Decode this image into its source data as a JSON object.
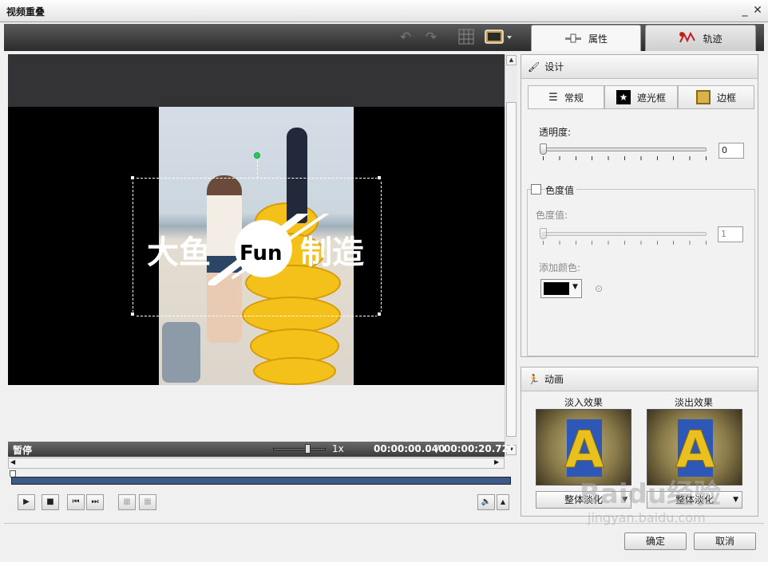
{
  "window": {
    "title": "视频重叠",
    "minimize": "_",
    "close": "✕"
  },
  "toolbar": {
    "icons": [
      "undo-icon",
      "redo-icon",
      "grid-icon",
      "monitor-icon"
    ]
  },
  "tabs": [
    {
      "label": "属性"
    },
    {
      "label": "轨迹"
    }
  ],
  "preview": {
    "overlay_text_left": "大鱼",
    "overlay_text_mid": "Fun",
    "overlay_text_right": "制造"
  },
  "status": {
    "state": "暂停",
    "speed": "1x",
    "current_time": "00:00:00.040",
    "separator": "/",
    "total_time": "00:00:20.720"
  },
  "design": {
    "section_title": "设计",
    "subtabs": [
      {
        "label": "常规"
      },
      {
        "label": "遮光框"
      },
      {
        "label": "边框"
      }
    ],
    "opacity_label": "透明度:",
    "opacity_value": "0",
    "opacity_level": 0,
    "chroma_checkbox_label": "色度值",
    "chroma_checked": false,
    "chroma_label": "色度值:",
    "chroma_value": "1",
    "add_color_label": "添加颜色:",
    "color_swatch": "#000000"
  },
  "animation": {
    "section_title": "动画",
    "fade_in_label": "淡入效果",
    "fade_out_label": "淡出效果",
    "fade_in_option": "整体淡化",
    "fade_out_option": "整体淡化"
  },
  "buttons": {
    "ok": "确定",
    "cancel": "取消"
  },
  "watermark": {
    "brand": "Baidu经验",
    "url": "jingyan.baidu.com"
  }
}
